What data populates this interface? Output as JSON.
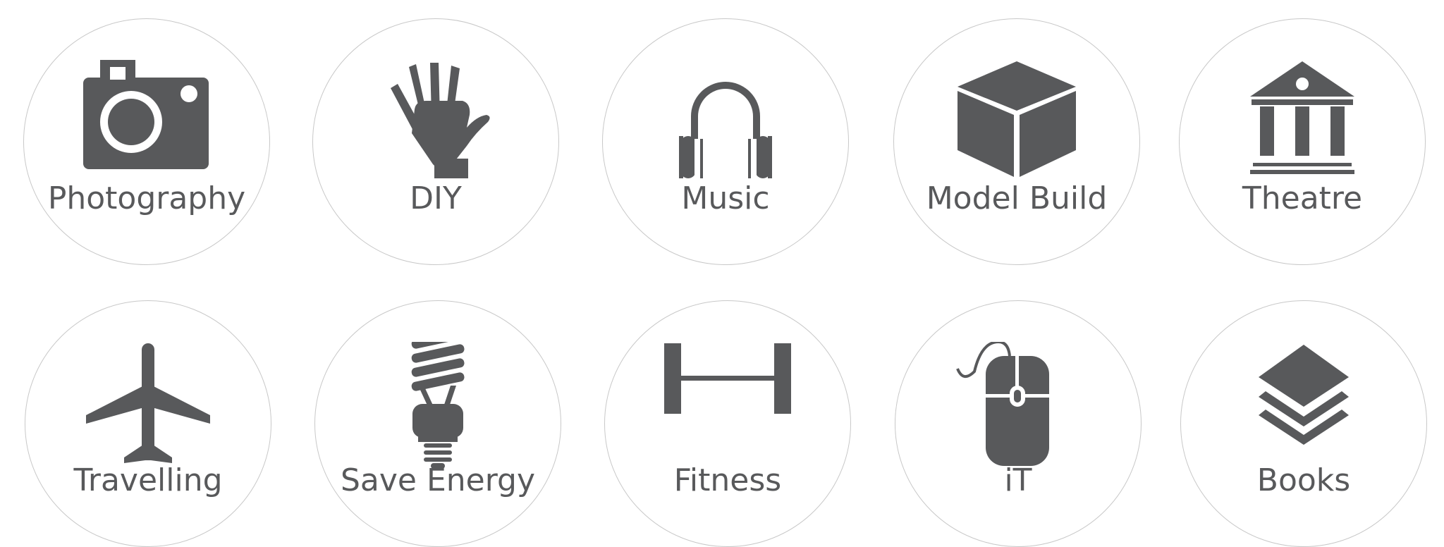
{
  "colors": {
    "icon": "#58595b",
    "text": "#58595b",
    "circle_border": "#c8c8c8",
    "background": "#ffffff"
  },
  "items": [
    {
      "label": "Photography",
      "icon": "camera-icon"
    },
    {
      "label": "DIY",
      "icon": "hand-icon"
    },
    {
      "label": "Music",
      "icon": "headphones-icon"
    },
    {
      "label": "Model Build",
      "icon": "cube-icon"
    },
    {
      "label": "Theatre",
      "icon": "museum-icon"
    },
    {
      "label": "Travelling",
      "icon": "airplane-icon"
    },
    {
      "label": "Save Energy",
      "icon": "energy-bulb-icon"
    },
    {
      "label": "Fitness",
      "icon": "barbell-icon"
    },
    {
      "label": "iT",
      "icon": "computer-mouse-icon"
    },
    {
      "label": "Books",
      "icon": "layers-icon"
    }
  ]
}
